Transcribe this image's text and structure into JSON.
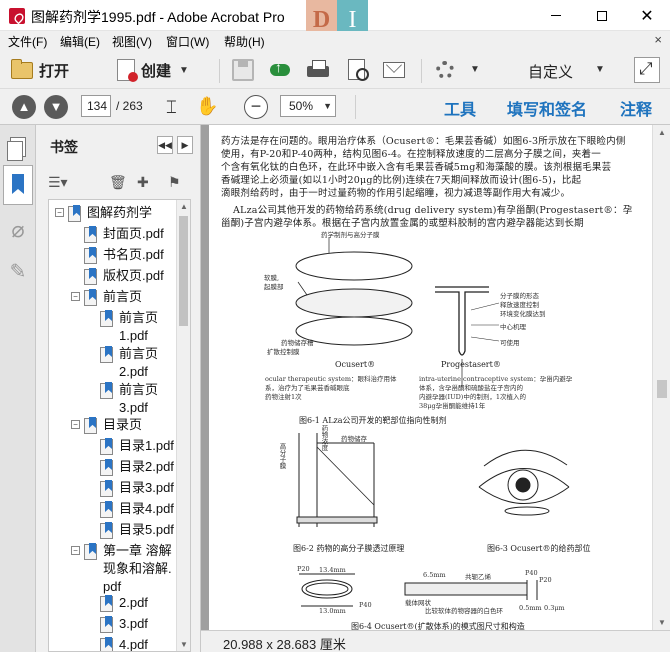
{
  "window": {
    "title": "图解药剂学1995.pdf - Adobe Acrobat Pro",
    "deco_left": "D",
    "deco_right": "I"
  },
  "menu": {
    "items": [
      "文件(F)",
      "编辑(E)",
      "视图(V)",
      "窗口(W)",
      "帮助(H)"
    ]
  },
  "toolbar": {
    "open_label": "打开",
    "create_label": "创建",
    "custom_label": "自定义"
  },
  "nav": {
    "current_page": "134",
    "total_pages": "/ 263",
    "zoom": "50%",
    "tabs": [
      "工具",
      "填写和签名",
      "注释"
    ]
  },
  "bookmarks": {
    "title": "书签",
    "items": [
      {
        "label": "图解药剂学",
        "level": 0,
        "toggle": "−"
      },
      {
        "label": "封面页.pdf",
        "level": 1
      },
      {
        "label": "书名页.pdf",
        "level": 1
      },
      {
        "label": "版权页.pdf",
        "level": 1
      },
      {
        "label": "前言页",
        "level": 1,
        "toggle": "−"
      },
      {
        "label": "前言页1.pdf",
        "level": 2
      },
      {
        "label": "前言页2.pdf",
        "level": 2
      },
      {
        "label": "前言页3.pdf",
        "level": 2
      },
      {
        "label": "目录页",
        "level": 1,
        "toggle": "−"
      },
      {
        "label": "目录1.pdf",
        "level": 2
      },
      {
        "label": "目录2.pdf",
        "level": 2
      },
      {
        "label": "目录3.pdf",
        "level": 2
      },
      {
        "label": "目录4.pdf",
        "level": 2
      },
      {
        "label": "目录5.pdf",
        "level": 2
      },
      {
        "label": "第一章 溶解现象和溶解.pdf",
        "level": 1,
        "toggle": "−"
      },
      {
        "label": "2.pdf",
        "level": 2
      },
      {
        "label": "3.pdf",
        "level": 2
      },
      {
        "label": "4.pdf",
        "level": 2
      }
    ]
  },
  "document": {
    "lines": [
      "药方法是存在问题的。眼用治疗体系（Ocusert®：毛果芸香碱）如图6-3所示放在下眼睑内侧",
      "使用，有P-20和P-40两种，结构见图6-4。在控制释放速度的二层高分子膜之间，夹着一",
      "个含有氧化钛的白色环，在此环中嵌入含有毛果芸香碱5mg和海藻酸的膜。该剂根据毛果芸",
      "香碱理论上必须量(如以1小时20μg的比例)连续在7天期间释放而设计(图6-5)，比起",
      "滴眼剂给药时，由于一时过量药物的作用引起缩瞳，视力减退等副作用大有减少。",
      "ALza公司其他开发的药物给药系统(drug delivery system)有孕甾酮(Progestasert®：孕",
      "甾酮)子宫内避孕体系。根据在子宫内放置金属的或塑料胶制的宫内避孕器能达到长期"
    ],
    "fig1_top_label": "药学制剂与高分子膜",
    "fig1_labels": [
      "软膜,",
      "起膜部",
      "药物储存槽",
      "扩散控制膜",
      "分子膜的形态",
      "释放速度控制",
      "环境变化膜达到",
      "中心机理",
      "可使用"
    ],
    "fig1_name_left": "Ocusert®",
    "fig1_name_right": "Progestasert®",
    "fig1_desc_left": [
      "ocular therapeutic system：眼科治疗用体",
      "系，治疗为了毛果芸香碱眼底",
      "药物注射1次"
    ],
    "fig1_desc_right": [
      "intra-uterine contraceptive system：孕甾内避孕",
      "体系，含孕甾酮和硫酸盐在子宫内的",
      "内避孕器(IUD)中的制剂，1次植入的",
      "38μg孕甾酮能维持1年"
    ],
    "fig1_caption": "图6-1  ALza公司开发的靶部位指向性制剂",
    "fig2_label_top": "药物浓度",
    "fig2_label_left": "高分子膜",
    "fig2_label_mid": "药物储存",
    "fig2_caption": "图6-2  药物的高分子膜透过原理",
    "fig3_caption": "图6-3  Ocusert®的给药部位",
    "fig4_caption": "图6-4  Ocusert®(扩散体系)的模式图尺寸和构造",
    "fig4_labels": [
      "P20",
      "13.4mm",
      "13.0mm",
      "P40",
      "6.5mm",
      "共轭乙烯",
      "P40",
      "P20",
      "0.5mm",
      "0.3μm",
      "载体网状",
      "比较软体药物容器的白色环"
    ],
    "page_size": "20.988 x 28.683 厘米"
  }
}
